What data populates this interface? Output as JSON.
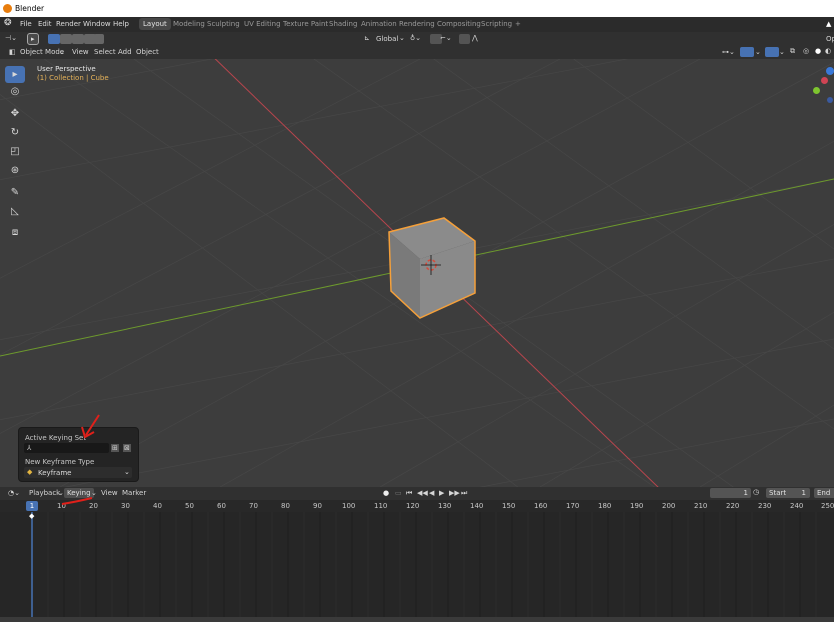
{
  "window": {
    "title": "Blender"
  },
  "menu": {
    "items": [
      "File",
      "Edit",
      "Render",
      "Window",
      "Help"
    ],
    "workspaces": [
      "Layout",
      "Modeling",
      "Sculpting",
      "UV Editing",
      "Texture Paint",
      "Shading",
      "Animation",
      "Rendering",
      "Compositing",
      "Scripting"
    ],
    "active_workspace": "Layout",
    "add_tab": "+"
  },
  "tool_settings": {
    "orientation": "Global",
    "options_clip": "Op"
  },
  "viewport_header": {
    "mode": "Object Mode",
    "items": [
      "View",
      "Select",
      "Add",
      "Object"
    ]
  },
  "viewport": {
    "perspective_label": "User Perspective",
    "collection_label": "(1) Collection | Cube"
  },
  "keying_popup": {
    "active_keying_set_label": "Active Keying Set",
    "new_keyframe_type_label": "New Keyframe Type",
    "keyframe_type_value": "Keyframe"
  },
  "timeline_header": {
    "items": [
      "Playback",
      "Keying",
      "View",
      "Marker"
    ],
    "current_frame": "1",
    "start_label": "Start",
    "start_value": "1",
    "end_label": "End"
  },
  "timeline_ruler": {
    "current": "1",
    "ticks": [
      "10",
      "20",
      "30",
      "40",
      "50",
      "60",
      "70",
      "80",
      "90",
      "100",
      "110",
      "120",
      "130",
      "140",
      "150",
      "160",
      "170",
      "180",
      "190",
      "200",
      "210",
      "220",
      "230",
      "240",
      "250"
    ]
  },
  "colors": {
    "accent_blue": "#4772b3",
    "selection_orange": "#f5a03a",
    "x_axis": "#b8454d",
    "y_axis": "#6d9a2d",
    "annotation_red": "#e0201a"
  },
  "icons": [
    "blender-logo-icon",
    "select-box-icon",
    "cursor-icon",
    "move-icon",
    "rotate-icon",
    "scale-icon",
    "transform-icon",
    "annotate-icon",
    "measure-icon",
    "add-cube-icon",
    "play-icon",
    "clock-icon"
  ]
}
